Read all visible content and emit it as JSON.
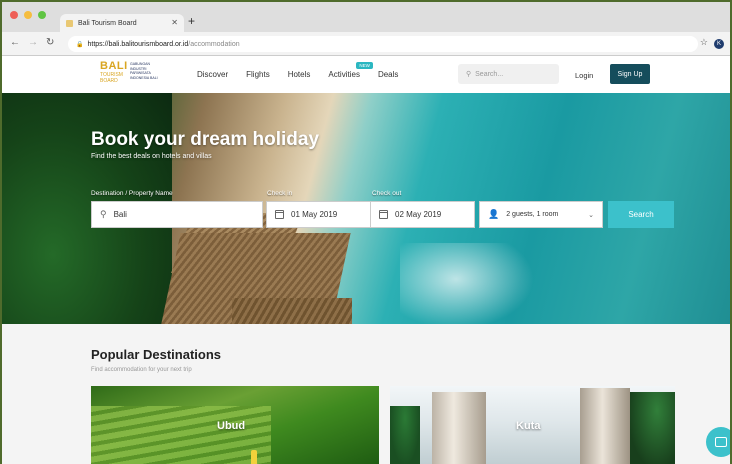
{
  "browser": {
    "tab_title": "Bali Tourism Board",
    "new_tab": "+",
    "url_host": "https://bali.balitourismboard.or.id",
    "url_path": "/accommodation",
    "profile_initial": "K",
    "window_dot_colors": [
      "#ee5f57",
      "#f5bd3f",
      "#5fc443"
    ]
  },
  "site": {
    "logo": {
      "big": "BALI",
      "line2": "TOURISM",
      "line3": "BOARD",
      "tagline": "GABUNGAN INDUSTRI PARIWISATA INDONESIA BALI"
    },
    "nav": [
      "Discover",
      "Flights",
      "Hotels",
      "Activities",
      "Deals"
    ],
    "new_badge": "NEW",
    "search_placeholder": "Search...",
    "login": "Login",
    "signup": "Sign Up",
    "brand_color": "#154d5c",
    "accent_color": "#3cc1cb"
  },
  "hero": {
    "title": "Book your dream holiday",
    "subtitle": "Find the best deals on hotels and villas",
    "destination_label": "Destination / Property Name",
    "destination_value": "Bali",
    "checkin_label": "Check in",
    "checkin_value": "01 May 2019",
    "checkout_label": "Check out",
    "checkout_value": "02 May 2019",
    "guests_value": "2 guests, 1 room",
    "search_button": "Search"
  },
  "popular": {
    "title": "Popular Destinations",
    "subtitle": "Find accommodation for your next trip",
    "cards": [
      {
        "name": "Ubud"
      },
      {
        "name": "Kuta"
      }
    ]
  }
}
